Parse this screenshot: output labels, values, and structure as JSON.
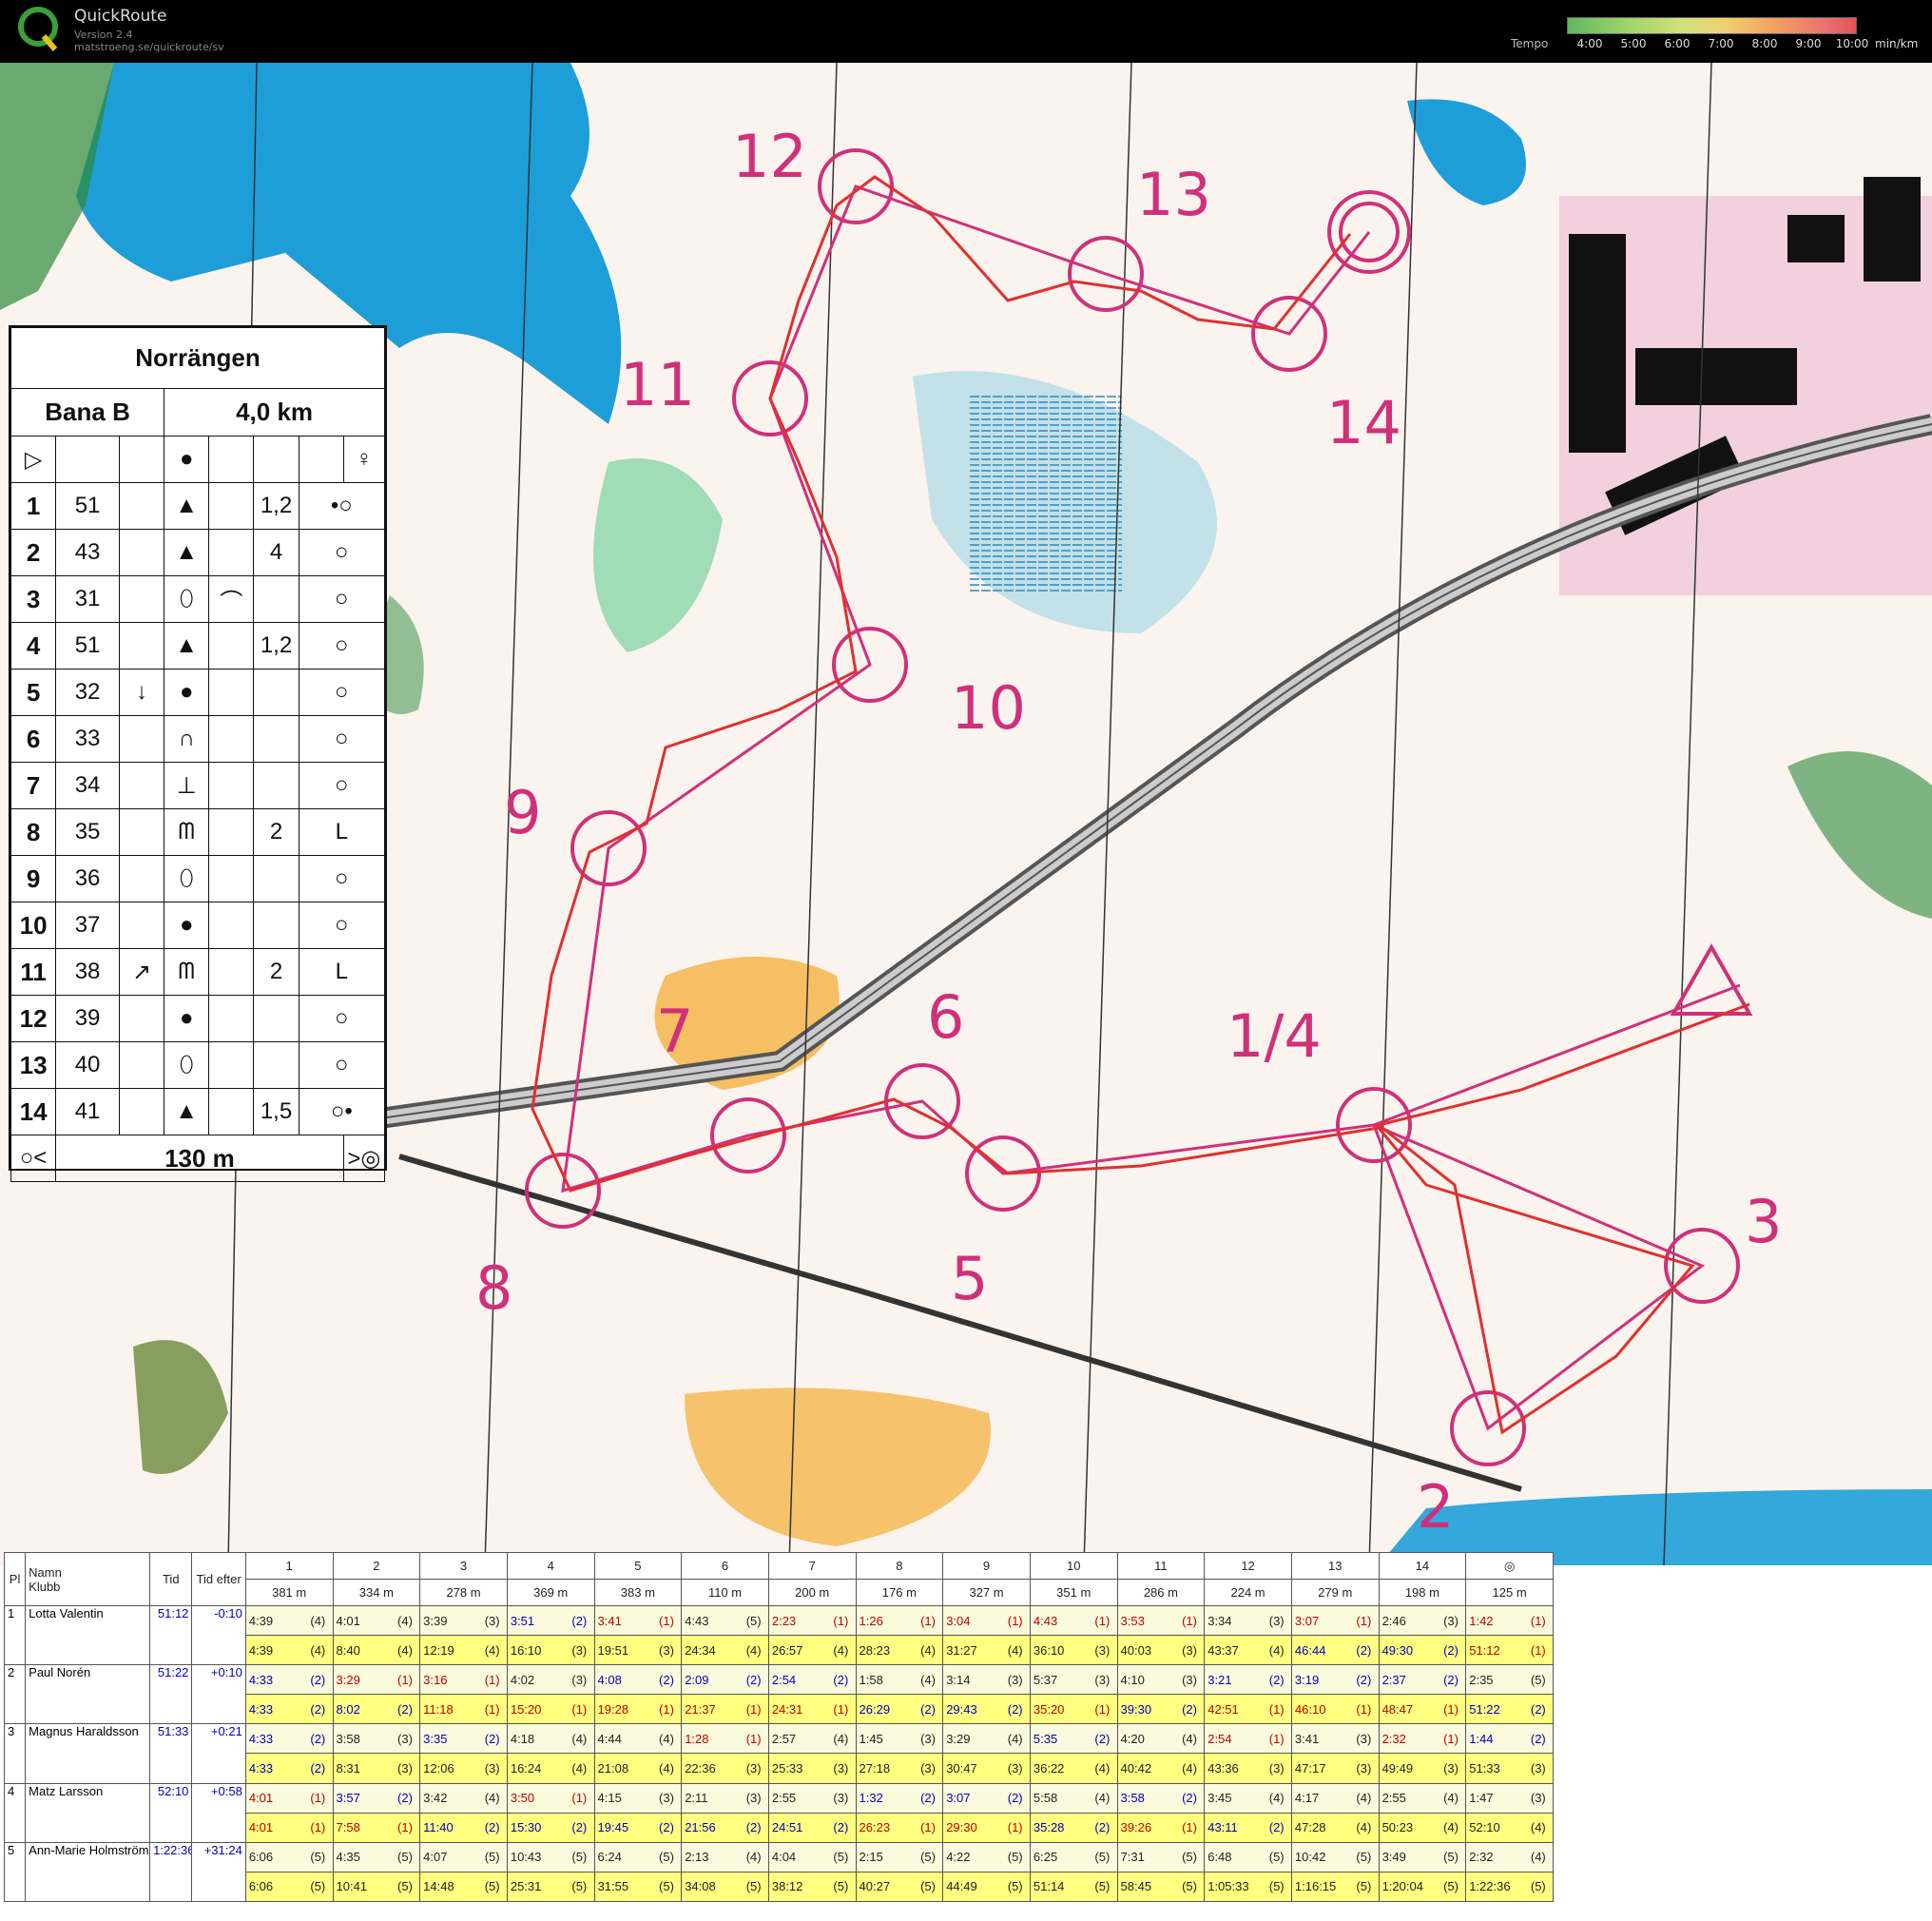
{
  "app": {
    "title": "QuickRoute",
    "version": "Version 2.4",
    "url": "matstroeng.se/quickroute/sv",
    "logo_letter": "Q"
  },
  "tempo": {
    "label": "Tempo",
    "ticks": [
      "4:00",
      "5:00",
      "6:00",
      "7:00",
      "8:00",
      "9:00",
      "10:00"
    ],
    "unit": "min/km"
  },
  "map_labels": [
    "12",
    "13",
    "11",
    "14",
    "10",
    "9",
    "7",
    "6",
    "1/4",
    "5",
    "3",
    "8",
    "2"
  ],
  "description": {
    "event": "Norrängen",
    "course": "Bana B",
    "length": "4,0 km",
    "rows": [
      {
        "n": "1",
        "code": "51",
        "c": "",
        "d": "",
        "e": "1,2"
      },
      {
        "n": "2",
        "code": "43",
        "c": "",
        "d": "",
        "e": "4"
      },
      {
        "n": "3",
        "code": "31",
        "c": "",
        "d": "",
        "e": ""
      },
      {
        "n": "4",
        "code": "51",
        "c": "",
        "d": "",
        "e": "1,2"
      },
      {
        "n": "5",
        "code": "32",
        "c": "↓",
        "d": "",
        "e": ""
      },
      {
        "n": "6",
        "code": "33",
        "c": "",
        "d": "",
        "e": ""
      },
      {
        "n": "7",
        "code": "34",
        "c": "",
        "d": "",
        "e": ""
      },
      {
        "n": "8",
        "code": "35",
        "c": "",
        "d": "",
        "e": "2"
      },
      {
        "n": "9",
        "code": "36",
        "c": "",
        "d": "",
        "e": ""
      },
      {
        "n": "10",
        "code": "37",
        "c": "",
        "d": "",
        "e": ""
      },
      {
        "n": "11",
        "code": "38",
        "c": "↗",
        "d": "",
        "e": "2"
      },
      {
        "n": "12",
        "code": "39",
        "c": "",
        "d": "",
        "e": ""
      },
      {
        "n": "13",
        "code": "40",
        "c": "",
        "d": "",
        "e": ""
      },
      {
        "n": "14",
        "code": "41",
        "c": "",
        "d": "",
        "e": "1,5"
      }
    ],
    "finish_distance": "130 m"
  },
  "results": {
    "headers": {
      "pl": "Pl",
      "namn": "Namn",
      "klubb": "Klubb",
      "tid": "Tid",
      "tid_efter": "Tid efter"
    },
    "legs": [
      {
        "n": "1",
        "d": "381 m"
      },
      {
        "n": "2",
        "d": "334 m"
      },
      {
        "n": "3",
        "d": "278 m"
      },
      {
        "n": "4",
        "d": "369 m"
      },
      {
        "n": "5",
        "d": "383 m"
      },
      {
        "n": "6",
        "d": "110 m"
      },
      {
        "n": "7",
        "d": "200 m"
      },
      {
        "n": "8",
        "d": "176 m"
      },
      {
        "n": "9",
        "d": "327 m"
      },
      {
        "n": "10",
        "d": "351 m"
      },
      {
        "n": "11",
        "d": "286 m"
      },
      {
        "n": "12",
        "d": "224 m"
      },
      {
        "n": "13",
        "d": "279 m"
      },
      {
        "n": "14",
        "d": "198 m"
      },
      {
        "n": "◎",
        "d": "125 m"
      }
    ],
    "runners": [
      {
        "pl": "1",
        "name": "Lotta Valentin",
        "tid": "51:12",
        "efter": "-0:10",
        "split": [
          [
            "4:39",
            "(4)"
          ],
          [
            "4:01",
            "(4)"
          ],
          [
            "3:39",
            "(3)"
          ],
          [
            "3:51",
            "(2)"
          ],
          [
            "3:41",
            "(1)"
          ],
          [
            "4:43",
            "(5)"
          ],
          [
            "2:23",
            "(1)"
          ],
          [
            "1:26",
            "(1)"
          ],
          [
            "3:04",
            "(1)"
          ],
          [
            "4:43",
            "(1)"
          ],
          [
            "3:53",
            "(1)"
          ],
          [
            "3:34",
            "(3)"
          ],
          [
            "3:07",
            "(1)"
          ],
          [
            "2:46",
            "(3)"
          ],
          [
            "1:42",
            "(1)"
          ]
        ],
        "cum": [
          [
            "4:39",
            "(4)"
          ],
          [
            "8:40",
            "(4)"
          ],
          [
            "12:19",
            "(4)"
          ],
          [
            "16:10",
            "(3)"
          ],
          [
            "19:51",
            "(3)"
          ],
          [
            "24:34",
            "(4)"
          ],
          [
            "26:57",
            "(4)"
          ],
          [
            "28:23",
            "(4)"
          ],
          [
            "31:27",
            "(4)"
          ],
          [
            "36:10",
            "(3)"
          ],
          [
            "40:03",
            "(3)"
          ],
          [
            "43:37",
            "(4)"
          ],
          [
            "46:44",
            "(2)"
          ],
          [
            "49:30",
            "(2)"
          ],
          [
            "51:12",
            "(1)"
          ]
        ]
      },
      {
        "pl": "2",
        "name": "Paul Norén",
        "tid": "51:22",
        "efter": "+0:10",
        "split": [
          [
            "4:33",
            "(2)"
          ],
          [
            "3:29",
            "(1)"
          ],
          [
            "3:16",
            "(1)"
          ],
          [
            "4:02",
            "(3)"
          ],
          [
            "4:08",
            "(2)"
          ],
          [
            "2:09",
            "(2)"
          ],
          [
            "2:54",
            "(2)"
          ],
          [
            "1:58",
            "(4)"
          ],
          [
            "3:14",
            "(3)"
          ],
          [
            "5:37",
            "(3)"
          ],
          [
            "4:10",
            "(3)"
          ],
          [
            "3:21",
            "(2)"
          ],
          [
            "3:19",
            "(2)"
          ],
          [
            "2:37",
            "(2)"
          ],
          [
            "2:35",
            "(5)"
          ]
        ],
        "cum": [
          [
            "4:33",
            "(2)"
          ],
          [
            "8:02",
            "(2)"
          ],
          [
            "11:18",
            "(1)"
          ],
          [
            "15:20",
            "(1)"
          ],
          [
            "19:28",
            "(1)"
          ],
          [
            "21:37",
            "(1)"
          ],
          [
            "24:31",
            "(1)"
          ],
          [
            "26:29",
            "(2)"
          ],
          [
            "29:43",
            "(2)"
          ],
          [
            "35:20",
            "(1)"
          ],
          [
            "39:30",
            "(2)"
          ],
          [
            "42:51",
            "(1)"
          ],
          [
            "46:10",
            "(1)"
          ],
          [
            "48:47",
            "(1)"
          ],
          [
            "51:22",
            "(2)"
          ]
        ]
      },
      {
        "pl": "3",
        "name": "Magnus Haraldsson",
        "tid": "51:33",
        "efter": "+0:21",
        "split": [
          [
            "4:33",
            "(2)"
          ],
          [
            "3:58",
            "(3)"
          ],
          [
            "3:35",
            "(2)"
          ],
          [
            "4:18",
            "(4)"
          ],
          [
            "4:44",
            "(4)"
          ],
          [
            "1:28",
            "(1)"
          ],
          [
            "2:57",
            "(4)"
          ],
          [
            "1:45",
            "(3)"
          ],
          [
            "3:29",
            "(4)"
          ],
          [
            "5:35",
            "(2)"
          ],
          [
            "4:20",
            "(4)"
          ],
          [
            "2:54",
            "(1)"
          ],
          [
            "3:41",
            "(3)"
          ],
          [
            "2:32",
            "(1)"
          ],
          [
            "1:44",
            "(2)"
          ]
        ],
        "cum": [
          [
            "4:33",
            "(2)"
          ],
          [
            "8:31",
            "(3)"
          ],
          [
            "12:06",
            "(3)"
          ],
          [
            "16:24",
            "(4)"
          ],
          [
            "21:08",
            "(4)"
          ],
          [
            "22:36",
            "(3)"
          ],
          [
            "25:33",
            "(3)"
          ],
          [
            "27:18",
            "(3)"
          ],
          [
            "30:47",
            "(3)"
          ],
          [
            "36:22",
            "(4)"
          ],
          [
            "40:42",
            "(4)"
          ],
          [
            "43:36",
            "(3)"
          ],
          [
            "47:17",
            "(3)"
          ],
          [
            "49:49",
            "(3)"
          ],
          [
            "51:33",
            "(3)"
          ]
        ]
      },
      {
        "pl": "4",
        "name": "Matz Larsson",
        "tid": "52:10",
        "efter": "+0:58",
        "split": [
          [
            "4:01",
            "(1)"
          ],
          [
            "3:57",
            "(2)"
          ],
          [
            "3:42",
            "(4)"
          ],
          [
            "3:50",
            "(1)"
          ],
          [
            "4:15",
            "(3)"
          ],
          [
            "2:11",
            "(3)"
          ],
          [
            "2:55",
            "(3)"
          ],
          [
            "1:32",
            "(2)"
          ],
          [
            "3:07",
            "(2)"
          ],
          [
            "5:58",
            "(4)"
          ],
          [
            "3:58",
            "(2)"
          ],
          [
            "3:45",
            "(4)"
          ],
          [
            "4:17",
            "(4)"
          ],
          [
            "2:55",
            "(4)"
          ],
          [
            "1:47",
            "(3)"
          ]
        ],
        "cum": [
          [
            "4:01",
            "(1)"
          ],
          [
            "7:58",
            "(1)"
          ],
          [
            "11:40",
            "(2)"
          ],
          [
            "15:30",
            "(2)"
          ],
          [
            "19:45",
            "(2)"
          ],
          [
            "21:56",
            "(2)"
          ],
          [
            "24:51",
            "(2)"
          ],
          [
            "26:23",
            "(1)"
          ],
          [
            "29:30",
            "(1)"
          ],
          [
            "35:28",
            "(2)"
          ],
          [
            "39:26",
            "(1)"
          ],
          [
            "43:11",
            "(2)"
          ],
          [
            "47:28",
            "(4)"
          ],
          [
            "50:23",
            "(4)"
          ],
          [
            "52:10",
            "(4)"
          ]
        ]
      },
      {
        "pl": "5",
        "name": "Ann-Marie Holmström",
        "tid": "1:22:36",
        "efter": "+31:24",
        "split": [
          [
            "6:06",
            "(5)"
          ],
          [
            "4:35",
            "(5)"
          ],
          [
            "4:07",
            "(5)"
          ],
          [
            "10:43",
            "(5)"
          ],
          [
            "6:24",
            "(5)"
          ],
          [
            "2:13",
            "(4)"
          ],
          [
            "4:04",
            "(5)"
          ],
          [
            "2:15",
            "(5)"
          ],
          [
            "4:22",
            "(5)"
          ],
          [
            "6:25",
            "(5)"
          ],
          [
            "7:31",
            "(5)"
          ],
          [
            "6:48",
            "(5)"
          ],
          [
            "10:42",
            "(5)"
          ],
          [
            "3:49",
            "(5)"
          ],
          [
            "2:32",
            "(4)"
          ]
        ],
        "cum": [
          [
            "6:06",
            "(5)"
          ],
          [
            "10:41",
            "(5)"
          ],
          [
            "14:48",
            "(5)"
          ],
          [
            "25:31",
            "(5)"
          ],
          [
            "31:55",
            "(5)"
          ],
          [
            "34:08",
            "(5)"
          ],
          [
            "38:12",
            "(5)"
          ],
          [
            "40:27",
            "(5)"
          ],
          [
            "44:49",
            "(5)"
          ],
          [
            "51:14",
            "(5)"
          ],
          [
            "58:45",
            "(5)"
          ],
          [
            "1:05:33",
            "(5)"
          ],
          [
            "1:16:15",
            "(5)"
          ],
          [
            "1:20:04",
            "(5)"
          ],
          [
            "1:22:36",
            "(5)"
          ]
        ]
      }
    ]
  }
}
